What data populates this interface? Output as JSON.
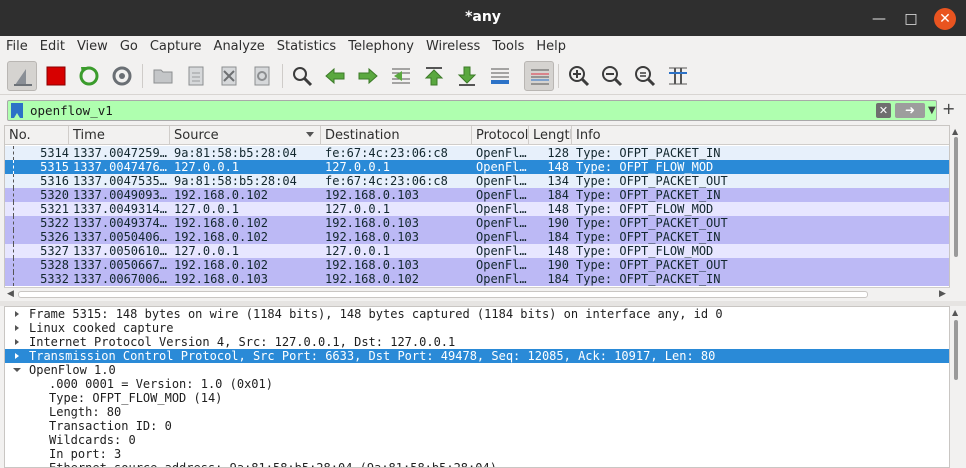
{
  "window": {
    "title": "*any"
  },
  "menu": [
    "File",
    "Edit",
    "View",
    "Go",
    "Capture",
    "Analyze",
    "Statistics",
    "Telephony",
    "Wireless",
    "Tools",
    "Help"
  ],
  "filter": {
    "value": "openflow_v1"
  },
  "columns": [
    "No.",
    "Time",
    "Source",
    "Destination",
    "Protocol",
    "Length",
    "Info"
  ],
  "colors": {
    "flowmod_bg": "#e7e6ff",
    "packet_bg": "#bcb9f5",
    "selected_bg": "#2a8ad7",
    "filter_bg": "#afffaf"
  },
  "packets": [
    {
      "no": "5314",
      "time": "1337.0047259…",
      "src": "9a:81:58:b5:28:04",
      "dst": "fe:67:4c:23:06:c8",
      "proto": "OpenFl…",
      "len": "128",
      "info": "Type: OFPT_PACKET_IN",
      "style": "light"
    },
    {
      "no": "5315",
      "time": "1337.0047476…",
      "src": "127.0.0.1",
      "dst": "127.0.0.1",
      "proto": "OpenFl…",
      "len": "148",
      "info": "Type: OFPT_FLOW_MOD",
      "style": "selected"
    },
    {
      "no": "5316",
      "time": "1337.0047535…",
      "src": "9a:81:58:b5:28:04",
      "dst": "fe:67:4c:23:06:c8",
      "proto": "OpenFl…",
      "len": "134",
      "info": "Type: OFPT_PACKET_OUT",
      "style": "light"
    },
    {
      "no": "5320",
      "time": "1337.0049093…",
      "src": "192.168.0.102",
      "dst": "192.168.0.103",
      "proto": "OpenFl…",
      "len": "184",
      "info": "Type: OFPT_PACKET_IN",
      "style": "dark"
    },
    {
      "no": "5321",
      "time": "1337.0049314…",
      "src": "127.0.0.1",
      "dst": "127.0.0.1",
      "proto": "OpenFl…",
      "len": "148",
      "info": "Type: OFPT_FLOW_MOD",
      "style": "flow"
    },
    {
      "no": "5322",
      "time": "1337.0049374…",
      "src": "192.168.0.102",
      "dst": "192.168.0.103",
      "proto": "OpenFl…",
      "len": "190",
      "info": "Type: OFPT_PACKET_OUT",
      "style": "dark"
    },
    {
      "no": "5326",
      "time": "1337.0050406…",
      "src": "192.168.0.102",
      "dst": "192.168.0.103",
      "proto": "OpenFl…",
      "len": "184",
      "info": "Type: OFPT_PACKET_IN",
      "style": "dark"
    },
    {
      "no": "5327",
      "time": "1337.0050610…",
      "src": "127.0.0.1",
      "dst": "127.0.0.1",
      "proto": "OpenFl…",
      "len": "148",
      "info": "Type: OFPT_FLOW_MOD",
      "style": "flow"
    },
    {
      "no": "5328",
      "time": "1337.0050667…",
      "src": "192.168.0.102",
      "dst": "192.168.0.103",
      "proto": "OpenFl…",
      "len": "190",
      "info": "Type: OFPT_PACKET_OUT",
      "style": "dark"
    },
    {
      "no": "5332",
      "time": "1337.0067006…",
      "src": "192.168.0.103",
      "dst": "192.168.0.102",
      "proto": "OpenFl…",
      "len": "184",
      "info": "Type: OFPT_PACKET_IN",
      "style": "dark"
    }
  ],
  "details": [
    {
      "text": "Frame 5315: 148 bytes on wire (1184 bits), 148 bytes captured (1184 bits) on interface any, id 0",
      "level": 0,
      "expand": "collapsed"
    },
    {
      "text": "Linux cooked capture",
      "level": 0,
      "expand": "collapsed"
    },
    {
      "text": "Internet Protocol Version 4, Src: 127.0.0.1, Dst: 127.0.0.1",
      "level": 0,
      "expand": "collapsed"
    },
    {
      "text": "Transmission Control Protocol, Src Port: 6633, Dst Port: 49478, Seq: 12085, Ack: 10917, Len: 80",
      "level": 0,
      "expand": "collapsed",
      "selected": true
    },
    {
      "text": "OpenFlow 1.0",
      "level": 0,
      "expand": "expanded"
    },
    {
      "text": ".000 0001 = Version: 1.0 (0x01)",
      "level": 1,
      "expand": "none"
    },
    {
      "text": "Type: OFPT_FLOW_MOD (14)",
      "level": 1,
      "expand": "none"
    },
    {
      "text": "Length: 80",
      "level": 1,
      "expand": "none"
    },
    {
      "text": "Transaction ID: 0",
      "level": 1,
      "expand": "none"
    },
    {
      "text": "Wildcards: 0",
      "level": 1,
      "expand": "none"
    },
    {
      "text": "In port: 3",
      "level": 1,
      "expand": "none"
    },
    {
      "text": "Ethernet source address: 9a:81:58:b5:28:04 (9a:81:58:b5:28:04)",
      "level": 1,
      "expand": "none"
    }
  ]
}
